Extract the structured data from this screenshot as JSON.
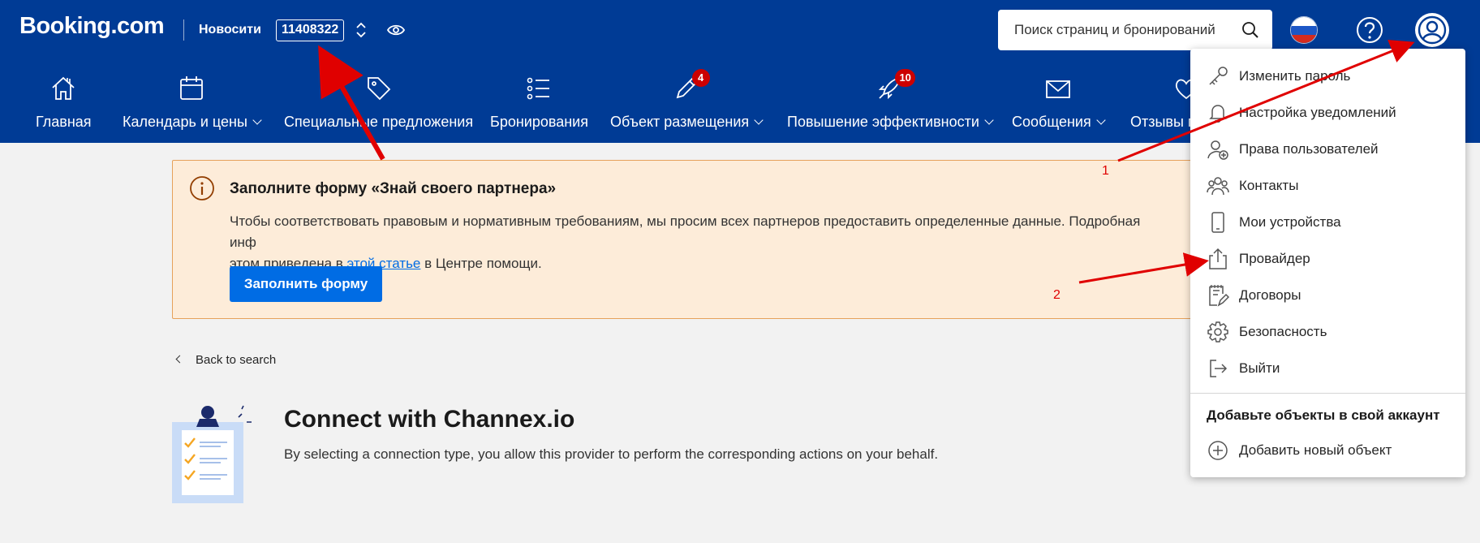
{
  "header": {
    "logo": "Booking.com",
    "hotel_name": "Новосити",
    "hotel_id": "11408322",
    "search_placeholder": "Поиск страниц и бронирований"
  },
  "nav": [
    {
      "label": "Главная",
      "icon": "home-icon"
    },
    {
      "label": "Календарь и цены",
      "icon": "calendar-icon"
    },
    {
      "label": "Специальные предложения",
      "icon": "tag-icon"
    },
    {
      "label": "Бронирования",
      "icon": "list-icon"
    },
    {
      "label": "Объект размещения",
      "icon": "pencil-icon",
      "badge": "4"
    },
    {
      "label": "Повышение эффективности",
      "icon": "rocket-icon",
      "badge": "10"
    },
    {
      "label": "Сообщения",
      "icon": "envelope-icon"
    },
    {
      "label": "Отзывы г",
      "icon": "heart-icon"
    }
  ],
  "alert": {
    "title": "Заполните форму «Знай своего партнера»",
    "text_before": "Чтобы соответствовать правовым и нормативным требованиям, мы просим всех партнеров предоставить определенные данные. Подробная инф",
    "text_line2_before": "этом приведена в ",
    "link": "этой статье",
    "text_after": " в Центре помощи.",
    "button": "Заполнить форму"
  },
  "back_link": "Back to search",
  "connect": {
    "title": "Connect with Channex.io",
    "subtitle": "By selecting a connection type, you allow this provider to perform the corresponding actions on your behalf."
  },
  "menu": {
    "items": [
      {
        "label": "Изменить пароль",
        "icon": "key-icon"
      },
      {
        "label": "Настройка уведомлений",
        "icon": "bell-icon"
      },
      {
        "label": "Права пользователей",
        "icon": "user-add-icon"
      },
      {
        "label": "Контакты",
        "icon": "contacts-icon"
      },
      {
        "label": "Мои устройства",
        "icon": "phone-icon"
      },
      {
        "label": "Провайдер",
        "icon": "upload-icon"
      },
      {
        "label": "Договоры",
        "icon": "contract-icon"
      },
      {
        "label": "Безопасность",
        "icon": "gear-icon"
      },
      {
        "label": "Выйти",
        "icon": "logout-icon"
      }
    ],
    "section_heading": "Добавьте объекты в свой аккаунт",
    "add_property": "Добавить новый объект"
  },
  "annotations": {
    "mark1": "1",
    "mark2": "2"
  },
  "colors": {
    "brand": "#003b95",
    "button": "#006ce4",
    "badge": "#cc0000",
    "annotation": "#e00000",
    "alert_bg": "#fdecd9"
  }
}
